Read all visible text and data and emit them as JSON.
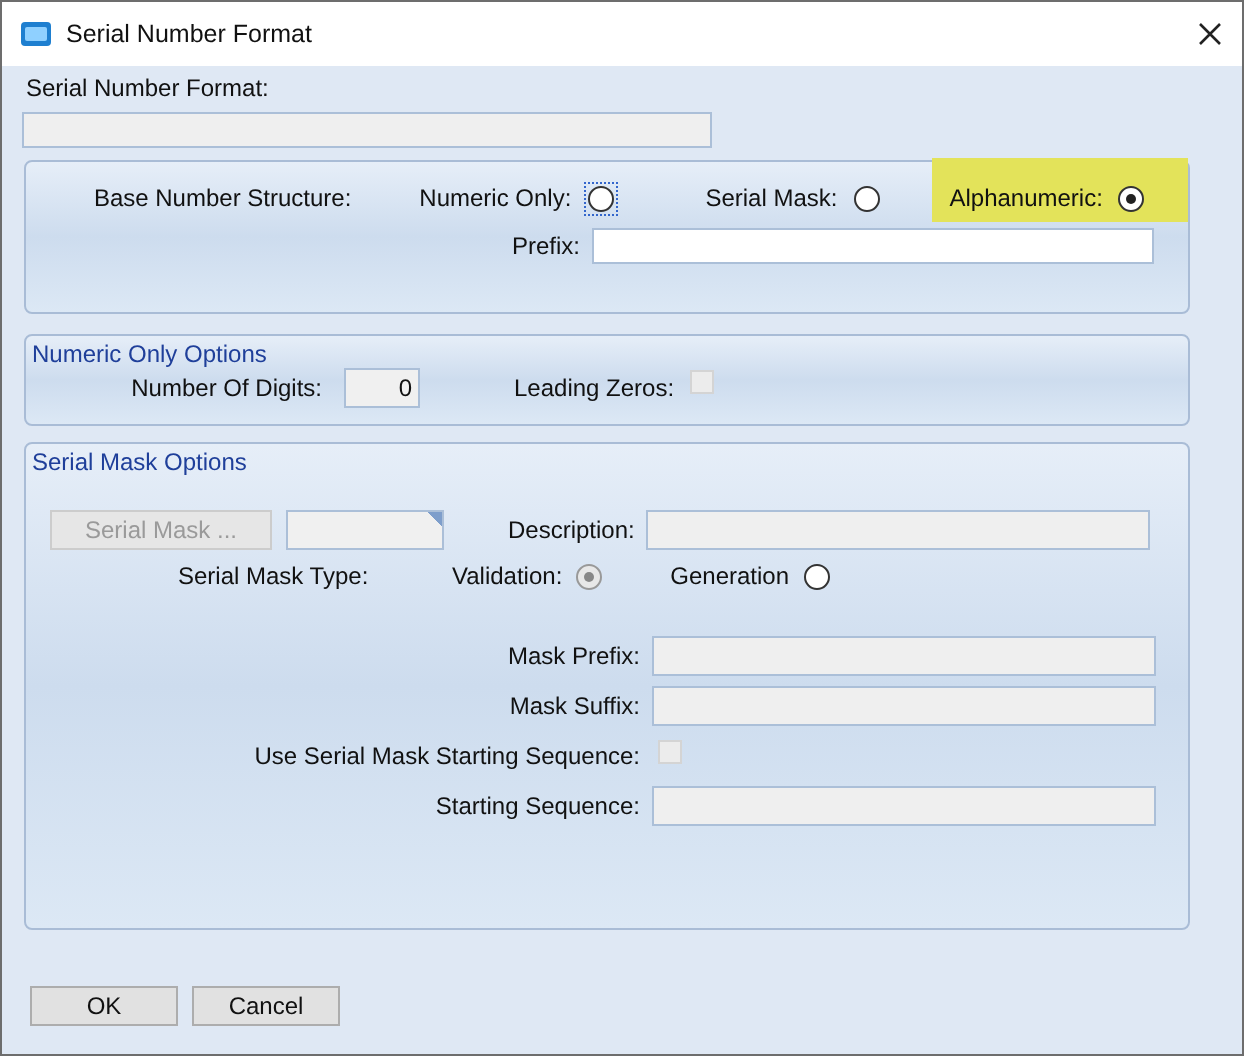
{
  "window": {
    "title": "Serial Number Format"
  },
  "serial_number_format": {
    "label": "Serial Number Format:",
    "disabled": true
  },
  "base_number_structure": {
    "label": "Base Number Structure:",
    "options": [
      {
        "label": "Numeric Only:",
        "selected": false,
        "focused": true,
        "highlighted": false
      },
      {
        "label": "Serial Mask:",
        "selected": false,
        "focused": false,
        "highlighted": false
      },
      {
        "label": "Alphanumeric:",
        "selected": true,
        "focused": false,
        "highlighted": true
      }
    ],
    "prefix": {
      "label": "Prefix:",
      "disabled": false
    }
  },
  "numeric_only_options": {
    "title": "Numeric Only Options",
    "number_of_digits": {
      "label": "Number Of Digits:",
      "value": "0"
    },
    "leading_zeros": {
      "label": "Leading Zeros:",
      "checked": false,
      "disabled": true
    }
  },
  "serial_mask_options": {
    "title": "Serial Mask Options",
    "serial_mask_button": {
      "label": "Serial Mask ...",
      "disabled": true
    },
    "description": {
      "label": "Description:",
      "disabled": true
    },
    "serial_mask_type": {
      "label": "Serial Mask Type:",
      "options": [
        {
          "label": "Validation:",
          "selected": true,
          "disabled": true
        },
        {
          "label": "Generation",
          "selected": false,
          "disabled": false
        }
      ]
    },
    "fields": [
      {
        "kind": "text",
        "label": "Mask Prefix:",
        "disabled": true
      },
      {
        "kind": "text",
        "label": "Mask Suffix:",
        "disabled": true
      },
      {
        "kind": "checkbox",
        "label": "Use Serial Mask Starting Sequence:",
        "checked": false,
        "disabled": true
      },
      {
        "kind": "text",
        "label": "Starting Sequence:",
        "disabled": true
      }
    ]
  },
  "buttons": [
    "OK",
    "Cancel"
  ]
}
